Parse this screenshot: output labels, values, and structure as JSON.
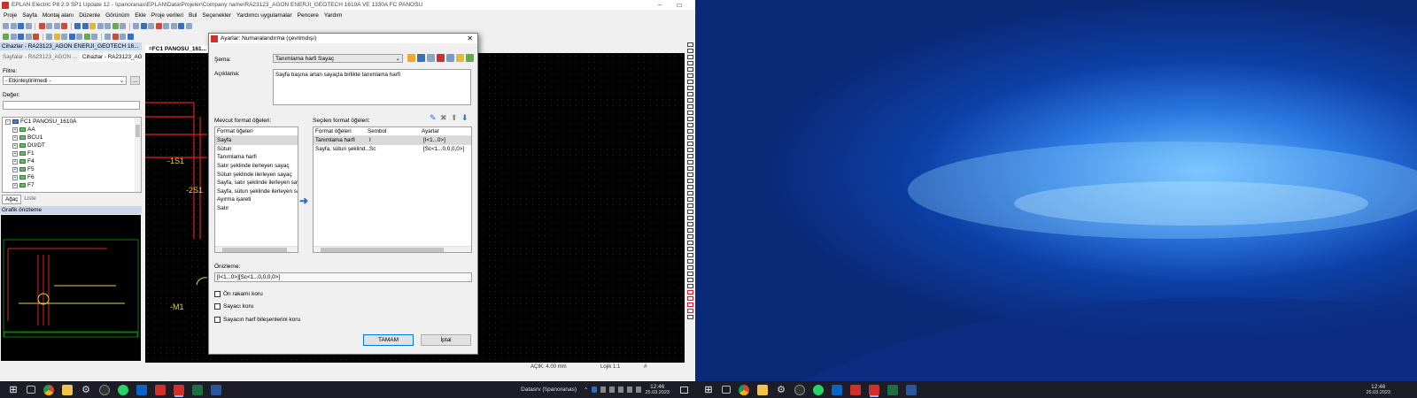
{
  "app": {
    "title": "EPLAN Electric P8 2.9 SP1 Update 12 - \\\\panoranas\\EPLAN\\Data\\Projeler\\Company name\\RA23123_AGON ENERJI_GEOTECH 1610A VE 1330A FC PANOSU",
    "menu": [
      "Proje",
      "Sayfa",
      "Montaj alanı",
      "Düzenle",
      "Görünüm",
      "Ekle",
      "Proje verileri",
      "Bul",
      "Seçenekler",
      "Yardımcı uygulamalar",
      "Pencere",
      "Yardım"
    ]
  },
  "devices_pane": {
    "header": "Cihazlar - RA23123_AGON ENERJI_GEOTECH 16...",
    "tabs": [
      "Sayfalar - RA23123_AGON ...",
      "Cihazlar - RA23123_AGON ..."
    ],
    "filter_label": "Filtre:",
    "filter_value": "- Etkinleştirilmedi -",
    "value_label": "Değer:",
    "tree_root": "FC1 PANOSU_1610A",
    "tree_items": [
      "AA",
      "BCU1",
      "DU/DT",
      "F1",
      "F4",
      "F5",
      "F6",
      "F7"
    ],
    "bottom_tabs": [
      "Ağaç",
      "Liste"
    ]
  },
  "preview_pane": {
    "header": "Grafik önizleme"
  },
  "canvas": {
    "tab_label": "=FC1 PANOSU_161...",
    "labels": [
      "-1S1",
      "-2S1",
      "-M1"
    ]
  },
  "status": {
    "grid": "AÇIK: 4.00 mm",
    "logic": "Lojik 1:1",
    "hash": "#"
  },
  "dialog": {
    "title": "Ayarlar: Numaralandırma (çevrimdışı)",
    "schema_label": "Şema:",
    "schema_value": "Tanımlama harfi Sayaç",
    "description_label": "Açıklama:",
    "description_value": "Sayfa başına artan sayaçla birlikte tanımlama harfi",
    "available_label": "Mevcut format öğeleri:",
    "available_header": "Format öğeleri",
    "available_items": [
      "Sayfa",
      "Sütun",
      "Tanımlama harfi",
      "Satır şeklinde ilerleyen sayaç",
      "Sütun şeklinde ilerleyen sayaç",
      "Sayfa, satır şeklinde ilerleyen sayaç",
      "Sayfa, sütun şeklinde ilerleyen sayaç",
      "Ayırma işareti",
      "Satır"
    ],
    "selected_label": "Seçilen format öğeleri:",
    "selected_headers": [
      "Format öğeleri",
      "Sembol",
      "Ayarlar"
    ],
    "selected_rows": [
      {
        "item": "Tanımlama harfi",
        "symbol": "I",
        "settings": "[I<1...0>]"
      },
      {
        "item": "Sayfa, sütun şeklind...",
        "symbol": "Sc",
        "settings": "[Sc<1...0,0,0,0>]"
      }
    ],
    "preview_label": "Önizleme:",
    "preview_value": "[I<1...0>][Sc<1...0,0,0,0>]",
    "checkboxes": [
      "Ön rakamı koru",
      "Sayacı koru",
      "Sayacın harf bileşenlerini koru"
    ],
    "ok_label": "TAMAM",
    "cancel_label": "İptal"
  },
  "taskbar_left": {
    "network_label": "Datasrv (\\\\panoranas)",
    "time": "12:46",
    "date": "25.03.2023"
  },
  "taskbar_right": {
    "time": "12:46",
    "date": "25.03.2023"
  }
}
